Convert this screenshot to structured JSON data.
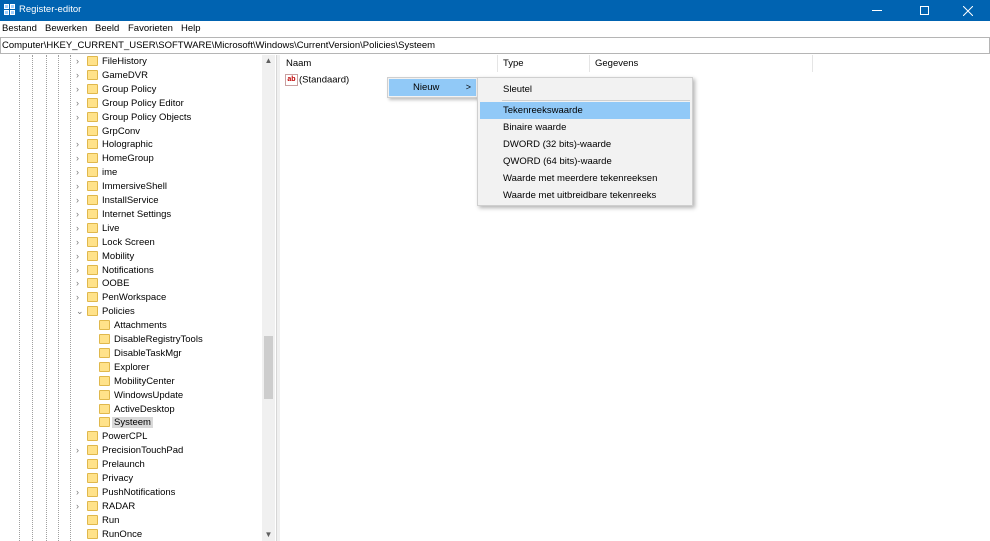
{
  "window": {
    "title": "Register-editor"
  },
  "menu": [
    "Bestand",
    "Bewerken",
    "Beeld",
    "Favorieten",
    "Help"
  ],
  "address": "Computer\\HKEY_CURRENT_USER\\SOFTWARE\\Microsoft\\Windows\\CurrentVersion\\Policies\\Systeem",
  "tree": {
    "items": [
      {
        "label": "FileHistory",
        "level": 1,
        "expander": "collapsed"
      },
      {
        "label": "GameDVR",
        "level": 1,
        "expander": "collapsed"
      },
      {
        "label": "Group Policy",
        "level": 1,
        "expander": "collapsed"
      },
      {
        "label": "Group Policy Editor",
        "level": 1,
        "expander": "collapsed"
      },
      {
        "label": "Group Policy Objects",
        "level": 1,
        "expander": "collapsed"
      },
      {
        "label": "GrpConv",
        "level": 1,
        "expander": "none"
      },
      {
        "label": "Holographic",
        "level": 1,
        "expander": "collapsed"
      },
      {
        "label": "HomeGroup",
        "level": 1,
        "expander": "collapsed"
      },
      {
        "label": "ime",
        "level": 1,
        "expander": "collapsed"
      },
      {
        "label": "ImmersiveShell",
        "level": 1,
        "expander": "collapsed"
      },
      {
        "label": "InstallService",
        "level": 1,
        "expander": "collapsed"
      },
      {
        "label": "Internet Settings",
        "level": 1,
        "expander": "collapsed"
      },
      {
        "label": "Live",
        "level": 1,
        "expander": "collapsed"
      },
      {
        "label": "Lock Screen",
        "level": 1,
        "expander": "collapsed"
      },
      {
        "label": "Mobility",
        "level": 1,
        "expander": "collapsed"
      },
      {
        "label": "Notifications",
        "level": 1,
        "expander": "collapsed"
      },
      {
        "label": "OOBE",
        "level": 1,
        "expander": "collapsed"
      },
      {
        "label": "PenWorkspace",
        "level": 1,
        "expander": "collapsed"
      },
      {
        "label": "Policies",
        "level": 1,
        "expander": "expanded"
      },
      {
        "label": "Attachments",
        "level": 2,
        "expander": "none"
      },
      {
        "label": "DisableRegistryTools",
        "level": 2,
        "expander": "none"
      },
      {
        "label": "DisableTaskMgr",
        "level": 2,
        "expander": "none"
      },
      {
        "label": "Explorer",
        "level": 2,
        "expander": "none"
      },
      {
        "label": "MobilityCenter",
        "level": 2,
        "expander": "none"
      },
      {
        "label": "WindowsUpdate",
        "level": 2,
        "expander": "none"
      },
      {
        "label": "ActiveDesktop",
        "level": 2,
        "expander": "none"
      },
      {
        "label": "Systeem",
        "level": 2,
        "expander": "none",
        "selected": true
      },
      {
        "label": "PowerCPL",
        "level": 1,
        "expander": "none"
      },
      {
        "label": "PrecisionTouchPad",
        "level": 1,
        "expander": "collapsed"
      },
      {
        "label": "Prelaunch",
        "level": 1,
        "expander": "none"
      },
      {
        "label": "Privacy",
        "level": 1,
        "expander": "none"
      },
      {
        "label": "PushNotifications",
        "level": 1,
        "expander": "collapsed"
      },
      {
        "label": "RADAR",
        "level": 1,
        "expander": "collapsed"
      },
      {
        "label": "Run",
        "level": 1,
        "expander": "none"
      },
      {
        "label": "RunOnce",
        "level": 1,
        "expander": "none"
      }
    ]
  },
  "list": {
    "columns": [
      "Naam",
      "Type",
      "Gegevens"
    ],
    "rows": [
      {
        "name": "(Standaard)",
        "icon": "ab"
      }
    ]
  },
  "context_menu": {
    "label": "Nieuw",
    "arrow": ">"
  },
  "submenu": {
    "items": [
      "Sleutel",
      "Tekenreekswaarde",
      "Binaire waarde",
      "DWORD (32 bits)-waarde",
      "QWORD (64 bits)-waarde",
      "Waarde met meerdere tekenreeksen",
      "Waarde met uitbreidbare tekenreeks"
    ],
    "highlighted_index": 1
  },
  "colors": {
    "titlebar": "#0063b1",
    "highlight": "#91c9f7",
    "folder": "#ffe28a"
  }
}
